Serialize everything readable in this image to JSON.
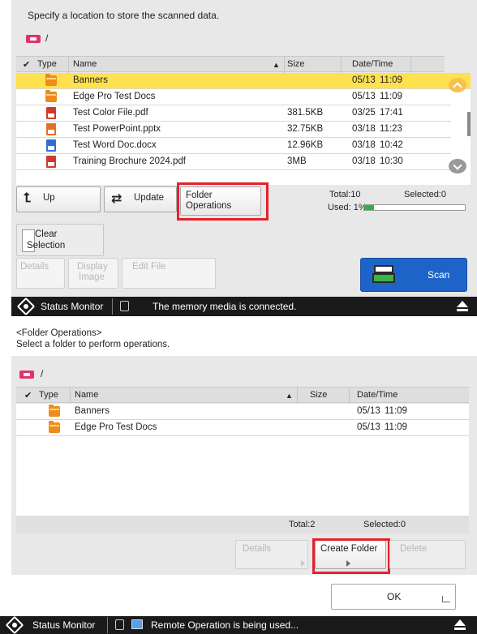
{
  "screen1": {
    "instruction": "Specify a location to store the scanned data.",
    "path": "/",
    "columns": {
      "check": "✔",
      "type": "Type",
      "name": "Name",
      "sort_arrow": "▲",
      "size": "Size",
      "datetime": "Date/Time"
    },
    "files": [
      {
        "icon": "folder-icon",
        "name": "Banners",
        "size": "",
        "date": "05/13",
        "time": "11:09",
        "selected": true
      },
      {
        "icon": "folder-icon",
        "name": "Edge Pro Test Docs",
        "size": "",
        "date": "05/13",
        "time": "11:09",
        "selected": false
      },
      {
        "icon": "pdf-file-icon",
        "name": "Test Color File.pdf",
        "size": "381.5KB",
        "date": "03/25",
        "time": "17:41",
        "selected": false
      },
      {
        "icon": "pptx-file-icon",
        "name": "Test PowerPoint.pptx",
        "size": "32.75KB",
        "date": "03/18",
        "time": "11:23",
        "selected": false
      },
      {
        "icon": "docx-file-icon",
        "name": "Test Word Doc.docx",
        "size": "12.96KB",
        "date": "03/18",
        "time": "10:42",
        "selected": false
      },
      {
        "icon": "pdf-file-icon",
        "name": "Training Brochure 2024.pdf",
        "size": "3MB",
        "date": "03/18",
        "time": "10:30",
        "selected": false
      }
    ],
    "buttons": {
      "up": "Up",
      "update": "Update",
      "folder_ops_line1": "Folder",
      "folder_ops_line2": "Operations",
      "clear_line1": "Clear",
      "clear_line2": "Selection",
      "details": "Details",
      "display_line1": "Display",
      "display_line2": "Image",
      "edit_file": "Edit File",
      "scan": "Scan"
    },
    "totals": {
      "total": "Total:10",
      "selected": "Selected:0",
      "used": "Used: 1%",
      "used_fraction": 0.1
    },
    "status": {
      "monitor": "Status Monitor",
      "message": "The memory media is connected."
    }
  },
  "screen2": {
    "title": "<Folder Operations>",
    "subtitle": "Select a folder to perform operations.",
    "path": "/",
    "columns": {
      "check": "✔",
      "type": "Type",
      "name": "Name",
      "sort_arrow": "▲",
      "size": "Size",
      "datetime": "Date/Time"
    },
    "folders": [
      {
        "icon": "folder-icon",
        "name": "Banners",
        "date": "05/13",
        "time": "11:09"
      },
      {
        "icon": "folder-icon",
        "name": "Edge Pro Test Docs",
        "date": "05/13",
        "time": "11:09"
      }
    ],
    "totals": {
      "total": "Total:2",
      "selected": "Selected:0"
    },
    "buttons": {
      "details": "Details",
      "create_folder": "Create Folder",
      "delete": "Delete",
      "ok": "OK"
    },
    "status": {
      "monitor": "Status Monitor",
      "message": "Remote Operation is being used..."
    }
  },
  "colors": {
    "selected_row": "#ffe14f",
    "highlight": "#e3222b",
    "scan_button": "#1e64c8",
    "status_bar": "#1a1a1a"
  }
}
